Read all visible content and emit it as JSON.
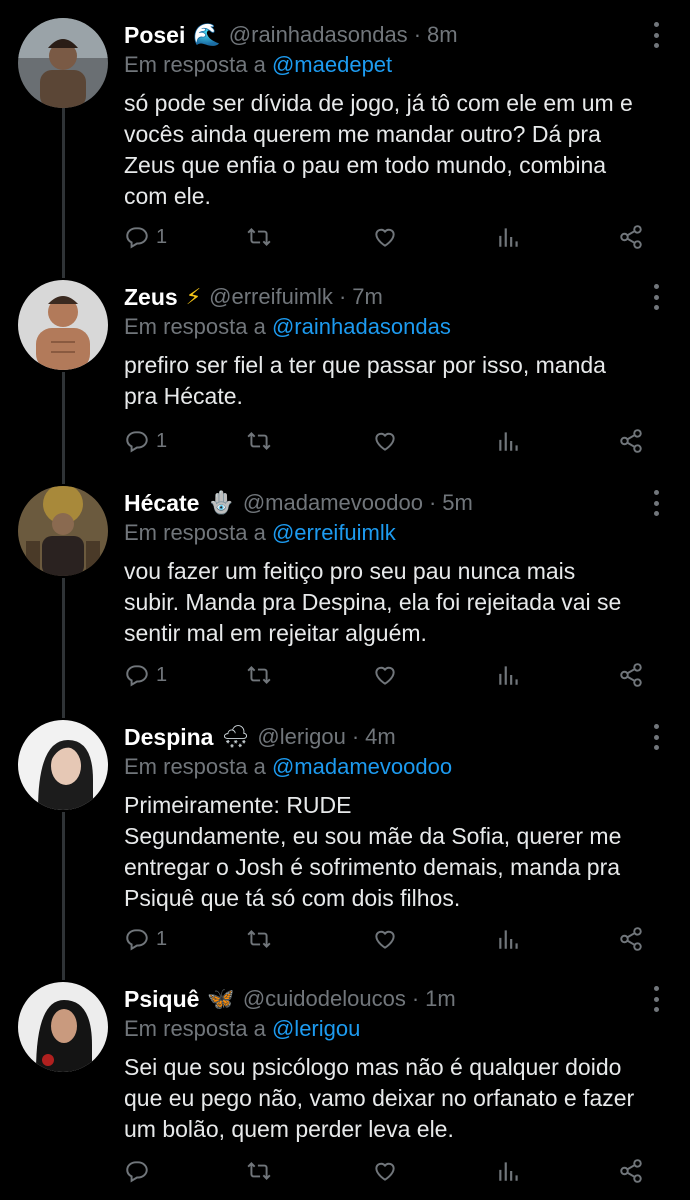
{
  "reply_prefix": "Em resposta a",
  "tweets": [
    {
      "display_name": "Posei",
      "emoji": "🌊",
      "handle": "@rainhadasondas",
      "dot": "·",
      "time": "8m",
      "reply_to": "@maedepet",
      "lines": [
        "só pode ser dívida de jogo, já tô com ele em um e",
        "vocês ainda querem me mandar outro? Dá pra",
        "Zeus que enfia o pau em todo mundo, combina",
        "com ele."
      ],
      "reply_count": "1"
    },
    {
      "display_name": "Zeus",
      "emoji": "⚡",
      "handle": "@erreifuimlk",
      "dot": "·",
      "time": "7m",
      "reply_to": "@rainhadasondas",
      "lines": [
        "prefiro ser fiel a ter que passar por isso, manda",
        "pra Hécate."
      ],
      "reply_count": "1"
    },
    {
      "display_name": "Hécate",
      "emoji": "🪬",
      "handle": "@madamevoodoo",
      "dot": "·",
      "time": "5m",
      "reply_to": "@erreifuimlk",
      "lines": [
        "vou fazer um feitiço pro seu pau nunca mais",
        "subir. Manda pra Despina, ela foi rejeitada vai se",
        "sentir mal em rejeitar alguém."
      ],
      "reply_count": "1"
    },
    {
      "display_name": "Despina",
      "emoji": "🌨",
      "handle": "@lerigou",
      "dot": "·",
      "time": "4m",
      "reply_to": "@madamevoodoo",
      "lines": [
        "Primeiramente: RUDE",
        "Segundamente, eu sou mãe da Sofia, querer me",
        "entregar o Josh é sofrimento demais, manda pra",
        "Psiquê que tá só com dois filhos."
      ],
      "reply_count": "1"
    },
    {
      "display_name": "Psiquê",
      "emoji": "🦋",
      "handle": "@cuidodeloucos",
      "dot": "·",
      "time": "1m",
      "reply_to": "@lerigou",
      "lines": [
        "Sei que sou psicólogo mas não é qualquer doido",
        "que eu pego não, vamo deixar no orfanato e fazer",
        "um bolão, quem perder leva ele."
      ],
      "reply_count": ""
    }
  ],
  "colors": {
    "background": "#000000",
    "text": "#e7e9ea",
    "muted": "#71767b",
    "link": "#1d9bf0",
    "thread_line": "#2f3336"
  },
  "icons": [
    "reply-icon",
    "retweet-icon",
    "like-icon",
    "views-icon",
    "share-icon",
    "more-options-icon"
  ]
}
